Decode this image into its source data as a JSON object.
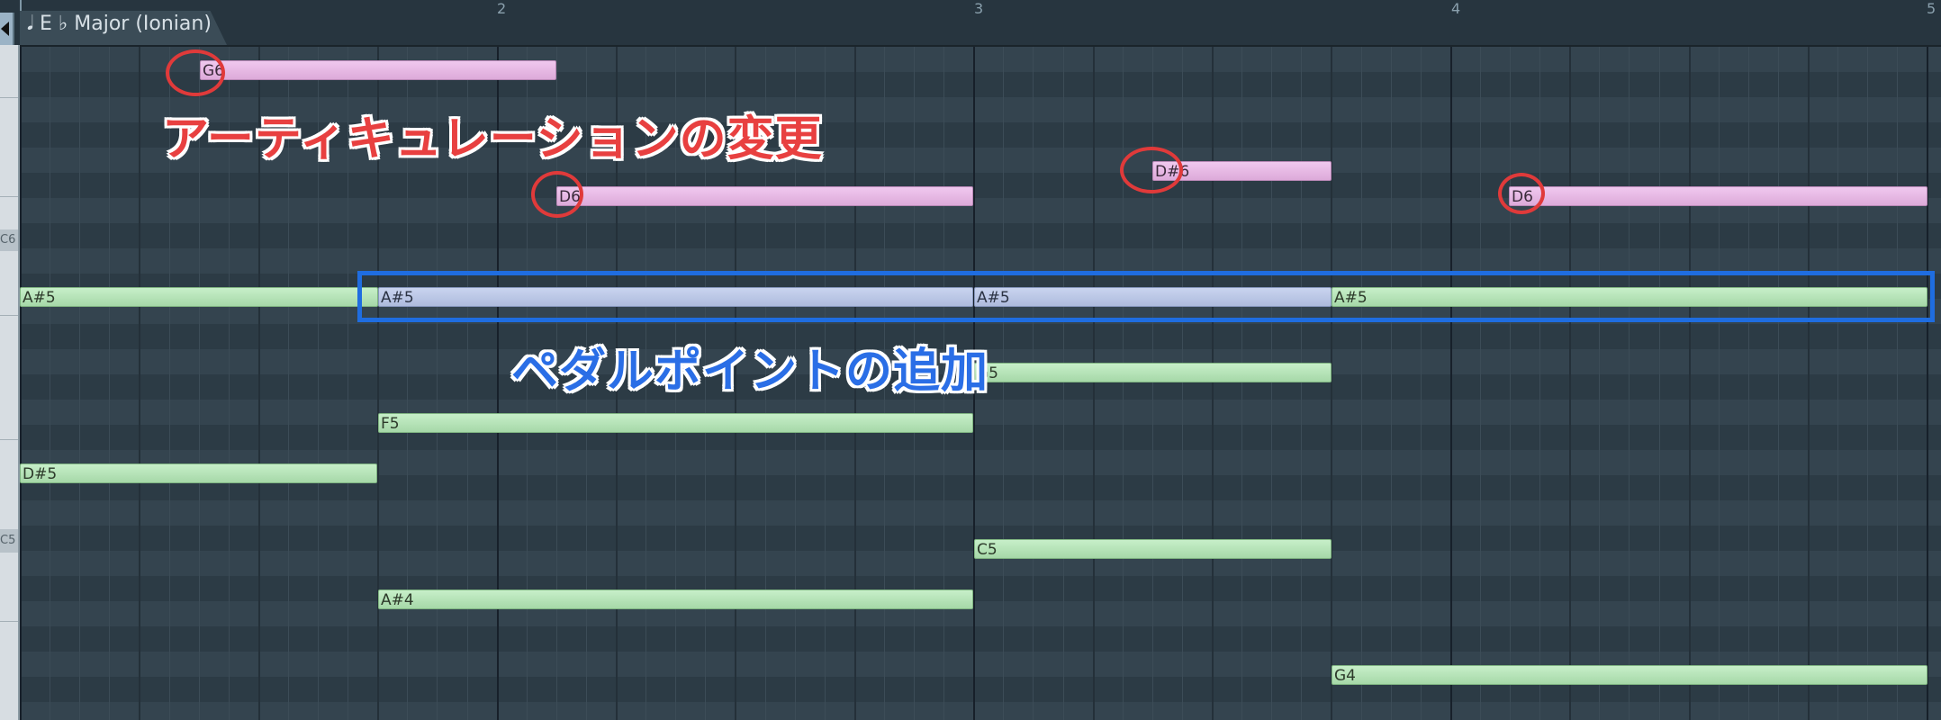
{
  "ruler": {
    "bar_numbers": [
      "2",
      "3",
      "4",
      "5"
    ],
    "scale_label": "𝅘𝅥 E ♭  Major (Ionian)"
  },
  "keyboard": {
    "labels": [
      "C6",
      "C5"
    ]
  },
  "notes": [
    {
      "id": "g6",
      "label": "G6",
      "color": "pink"
    },
    {
      "id": "d6-a",
      "label": "D6",
      "color": "pink"
    },
    {
      "id": "ds6",
      "label": "D#6",
      "color": "pink"
    },
    {
      "id": "d6-b",
      "label": "D6",
      "color": "pink"
    },
    {
      "id": "as5-a",
      "label": "A#5",
      "color": "green"
    },
    {
      "id": "as5-b",
      "label": "A#5",
      "color": "blue"
    },
    {
      "id": "as5-c",
      "label": "A#5",
      "color": "blue"
    },
    {
      "id": "as5-d",
      "label": "A#5",
      "color": "green"
    },
    {
      "id": "g5",
      "label": "G5",
      "color": "green"
    },
    {
      "id": "f5",
      "label": "F5",
      "color": "green"
    },
    {
      "id": "ds5",
      "label": "D#5",
      "color": "green"
    },
    {
      "id": "c5",
      "label": "C5",
      "color": "green"
    },
    {
      "id": "as4",
      "label": "A#4",
      "color": "green"
    },
    {
      "id": "g4",
      "label": "G4",
      "color": "green"
    }
  ],
  "annotations": {
    "articulation": "アーティキュレーションの変更",
    "pedal_point": "ペダルポイントの追加"
  },
  "colors": {
    "annotation_red": "#e84040",
    "annotation_blue": "#2a6ee6",
    "note_green": "#b6e2b8",
    "note_pink": "#e8bde6",
    "note_blue": "#bcc7e6"
  }
}
